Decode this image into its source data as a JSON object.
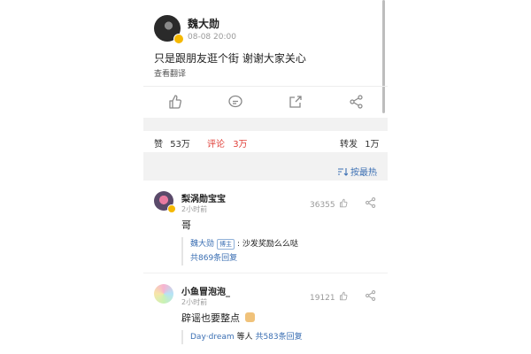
{
  "post": {
    "author": "魏大勋",
    "time": "08-08 20:00",
    "text": "只是跟朋友逛个街 谢谢大家关心",
    "translate": "查看翻译"
  },
  "stats": {
    "likes_label": "赞",
    "likes_value": "53万",
    "comments_label": "评论",
    "comments_value": "3万",
    "reposts_label": "转发",
    "reposts_value": "1万"
  },
  "sort": {
    "label": "按最热"
  },
  "comments": [
    {
      "name": "梨涡勋宝宝",
      "time": "2小时前",
      "likes": "36355",
      "text": "哥",
      "reply": {
        "author": "魏大勋",
        "tag": "博主",
        "text": ": 沙发奖励么么哒",
        "more": "共869条回复"
      }
    },
    {
      "name": "小鱼冒泡泡_",
      "time": "2小时前",
      "likes": "19121",
      "text": "辟谣也要整点",
      "reply": {
        "author": "Day·dream",
        "middle": "等人",
        "more": "共583条回复"
      }
    }
  ],
  "icons": [
    "like-icon",
    "comment-icon",
    "repost-icon",
    "share-icon",
    "sort-icon"
  ],
  "colors": {
    "link": "#3b6fb3",
    "active_tab": "#e0413a",
    "verified": "#f5b800"
  }
}
